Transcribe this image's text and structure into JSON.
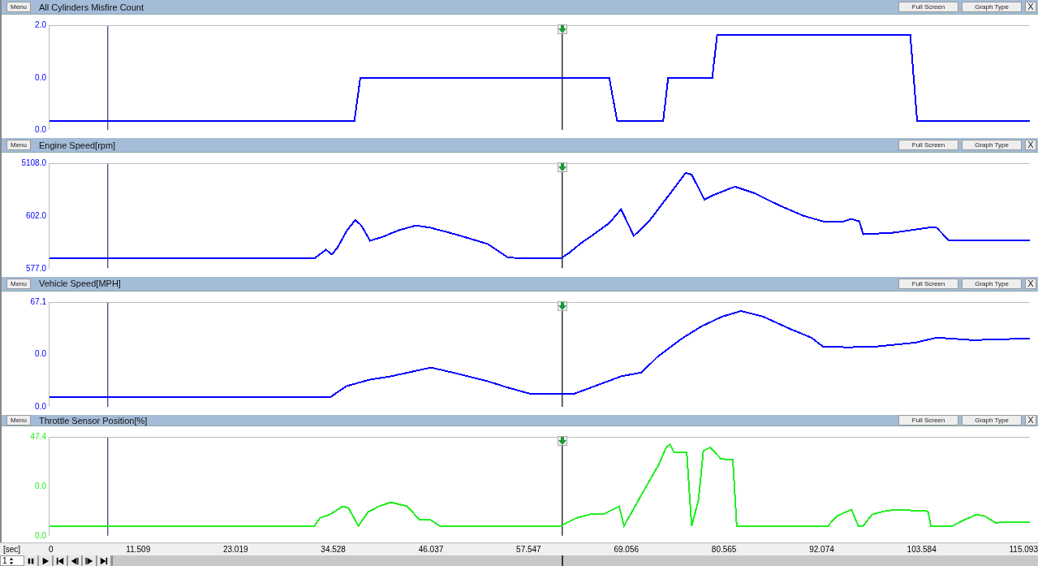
{
  "panels": [
    {
      "title": "All Cylinders Misfire Count",
      "color": "#0000ff",
      "y_labels": [
        "2.0",
        "0.0",
        "0.0"
      ],
      "menu": "Menu",
      "full_screen": "Full Screen",
      "graph_type": "Graph Type",
      "close": "X"
    },
    {
      "title": "Engine Speed[rpm]",
      "color": "#0000ff",
      "y_labels": [
        "5108.0",
        "602.0",
        "577.0"
      ],
      "menu": "Menu",
      "full_screen": "Full Screen",
      "graph_type": "Graph Type",
      "close": "X"
    },
    {
      "title": "Vehicle Speed[MPH]",
      "color": "#0000ff",
      "y_labels": [
        "67.1",
        "0.0",
        "0.0"
      ],
      "menu": "Menu",
      "full_screen": "Full Screen",
      "graph_type": "Graph Type",
      "close": "X"
    },
    {
      "title": "Throttle Sensor Position[%]",
      "color": "#22ee22",
      "y_labels": [
        "47.4",
        "0.0",
        "0.0"
      ],
      "menu": "Menu",
      "full_screen": "Full Screen",
      "graph_type": "Graph Type",
      "close": "X"
    }
  ],
  "x_axis": {
    "unit": "[sec]",
    "ticks": [
      "0",
      "11.509",
      "23.019",
      "34.528",
      "46.037",
      "57.547",
      "69.056",
      "80.565",
      "92.074",
      "103.584",
      "115.093"
    ]
  },
  "playback": {
    "speed": "1"
  }
}
